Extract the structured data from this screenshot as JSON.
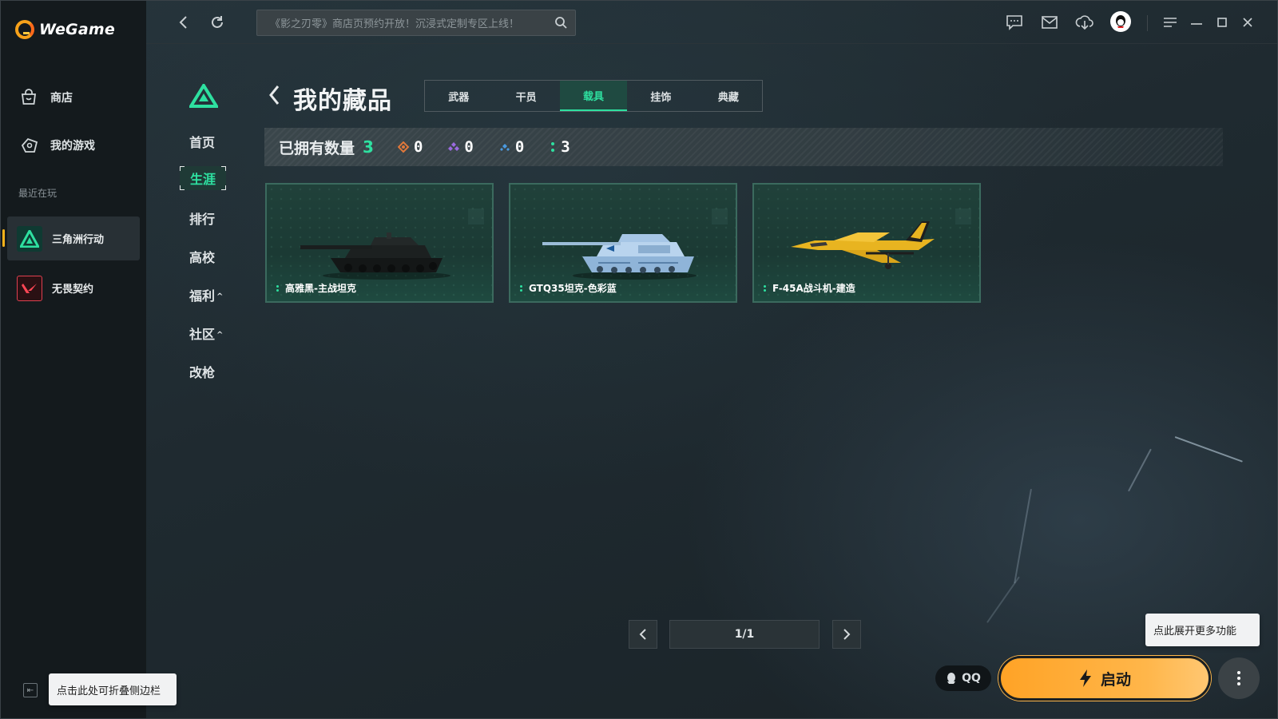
{
  "app": {
    "name": "WeGame"
  },
  "sidebar": {
    "items": [
      {
        "label": "商店",
        "icon": "store-bag-icon"
      },
      {
        "label": "我的游戏",
        "icon": "my-games-icon"
      }
    ],
    "section_label": "最近在玩",
    "recent": [
      {
        "label": "三角洲行动",
        "icon": "delta-force-icon",
        "active": true
      },
      {
        "label": "无畏契约",
        "icon": "valorant-icon",
        "active": false
      }
    ],
    "collapse_tooltip": "点击此处可折叠侧边栏"
  },
  "topbar": {
    "search_placeholder": "《影之刃零》商店页预约开放！沉浸式定制专区上线！",
    "icons": [
      "chat-icon",
      "mail-icon",
      "download-icon",
      "qq-avatar-icon",
      "menu-icon",
      "minimize-icon",
      "maximize-icon",
      "close-icon"
    ]
  },
  "game_nav": {
    "items": [
      {
        "label": "首页",
        "active": false,
        "expand": ""
      },
      {
        "label": "生涯",
        "active": true,
        "expand": ""
      },
      {
        "label": "排行",
        "active": false,
        "expand": ""
      },
      {
        "label": "高校",
        "active": false,
        "expand": ""
      },
      {
        "label": "福利",
        "active": false,
        "expand": "^"
      },
      {
        "label": "社区",
        "active": false,
        "expand": "^"
      },
      {
        "label": "改枪",
        "active": false,
        "expand": ""
      }
    ]
  },
  "collection": {
    "title": "我的藏品",
    "tabs": [
      {
        "label": "武器",
        "active": false
      },
      {
        "label": "干员",
        "active": false
      },
      {
        "label": "载具",
        "active": true
      },
      {
        "label": "挂饰",
        "active": false
      },
      {
        "label": "典藏",
        "active": false
      }
    ],
    "owned_label": "已拥有数量",
    "owned_total": "3",
    "rarity_counts": [
      {
        "icon": "orange-rarity-icon",
        "color": "#e0783a",
        "count": "0"
      },
      {
        "icon": "purple-rarity-icon",
        "color": "#9a6ae0",
        "count": "0"
      },
      {
        "icon": "blue-rarity-icon",
        "color": "#4a9ae0",
        "count": "0"
      },
      {
        "icon": "green-rarity-icon",
        "color": "#2ee0a0",
        "count": "3"
      }
    ],
    "cards": [
      {
        "name": "高雅黑-主战坦克",
        "vehicle": "black-tank-image"
      },
      {
        "name": "GTQ35坦克-色彩蓝",
        "vehicle": "blue-tank-image"
      },
      {
        "name": "F-45A战斗机-建造",
        "vehicle": "yellow-jet-image"
      }
    ]
  },
  "pagination": {
    "text": "1/1"
  },
  "footer": {
    "qq_label": "QQ",
    "launch_label": "启动",
    "more_tooltip": "点此展开更多功能"
  },
  "colors": {
    "accent_green": "#2ee0a0",
    "launch_orange": "#ffa326"
  }
}
